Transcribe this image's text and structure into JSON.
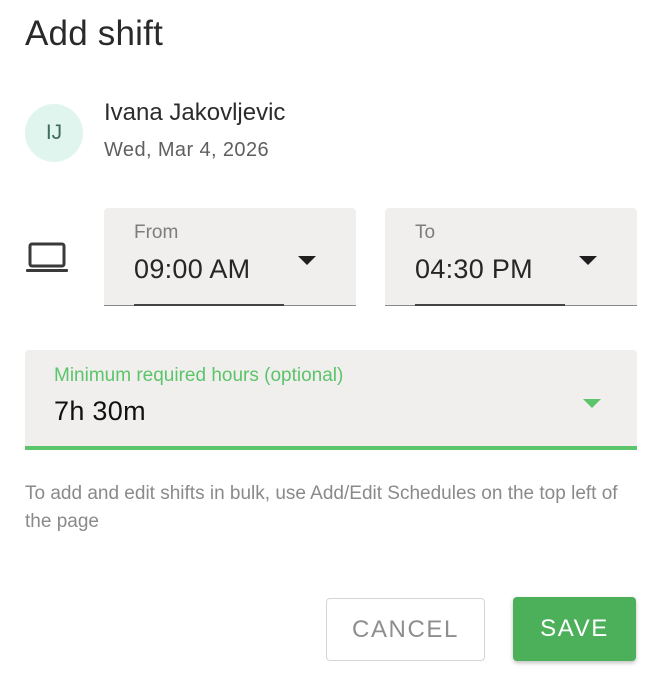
{
  "dialog": {
    "title": "Add shift"
  },
  "user": {
    "initials": "IJ",
    "name": "Ivana Jakovljevic",
    "date": "Wed, Mar 4, 2026"
  },
  "from_field": {
    "label": "From",
    "value": "09:00 AM"
  },
  "to_field": {
    "label": "To",
    "value": "04:30 PM"
  },
  "hours_field": {
    "label": "Minimum required hours (optional)",
    "value": "7h 30m"
  },
  "helper_text": "To add and edit shifts in bulk, use Add/Edit Schedules on the top left of the page",
  "actions": {
    "cancel_label": "CANCEL",
    "save_label": "SAVE"
  },
  "icons": {
    "device": "laptop-icon"
  },
  "colors": {
    "accent": "#5cc46a",
    "save_button": "#4caf5a",
    "avatar_bg": "#dff5ee"
  }
}
